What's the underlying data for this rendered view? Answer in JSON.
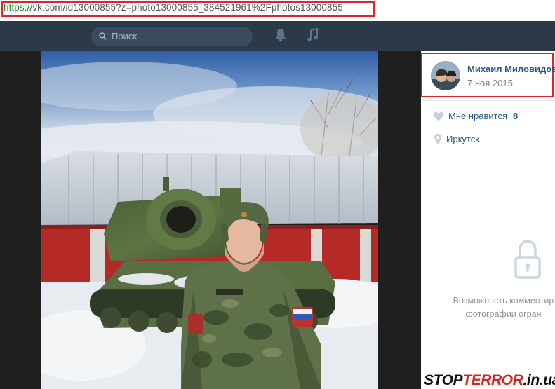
{
  "browser": {
    "url_scheme": "https://",
    "url_rest": "vk.com/id13000855?z=photo13000855_384521961%2Fphotos13000855"
  },
  "header": {
    "search_placeholder": "Поиск",
    "icons": [
      "search-icon",
      "bell-icon",
      "music-icon"
    ]
  },
  "photo": {
    "description": "photo"
  },
  "owner": {
    "name": "Михаил Миловидов",
    "date": "7 ноя 2015"
  },
  "actions": {
    "like_label": "Мне нравится",
    "like_count": "8",
    "place": "Иркутск"
  },
  "comments": {
    "line1": "Возможность комментир",
    "line2": "фотографии огран"
  },
  "watermark": {
    "text": "STOPTERROR.in.ua"
  },
  "colors": {
    "vk_header": "#2b3948",
    "link": "#2a5885",
    "highlight": "#e0242c"
  }
}
